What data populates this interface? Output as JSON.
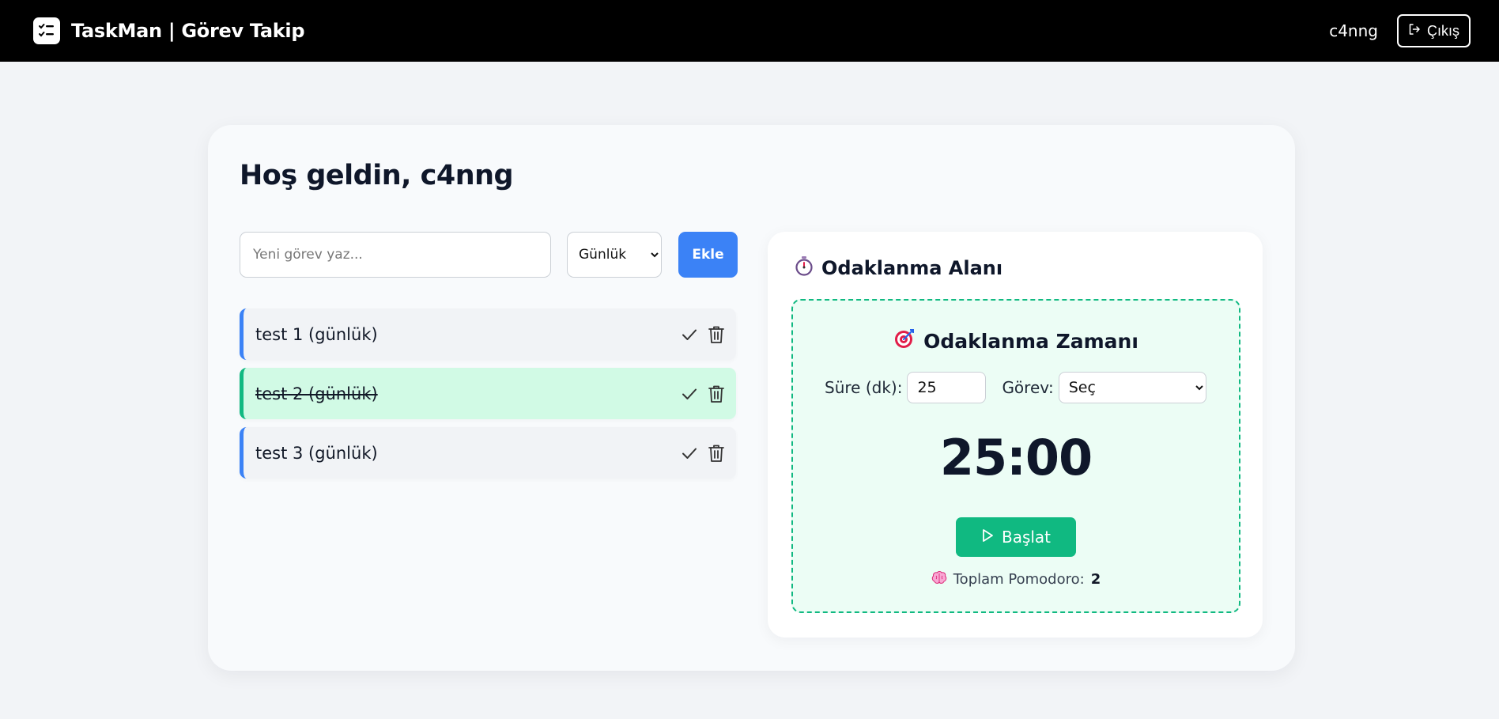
{
  "header": {
    "title": "TaskMan | Görev Takip",
    "username": "c4nng",
    "logout_label": "Çıkış"
  },
  "main": {
    "welcome": "Hoş geldin, c4nng",
    "new_task": {
      "placeholder": "Yeni görev yaz...",
      "period_selected": "Günlük",
      "add_label": "Ekle"
    },
    "tasks": [
      {
        "text": "test 1 (günlük)",
        "done": false
      },
      {
        "text": "test 2 (günlük)",
        "done": true
      },
      {
        "text": "test 3 (günlük)",
        "done": false
      }
    ]
  },
  "focus": {
    "title": "Odaklanma Alanı",
    "timer_title": "Odaklanma Zamanı",
    "duration_label": "Süre (dk):",
    "duration_value": "25",
    "task_label": "Görev:",
    "task_selected": "Seç",
    "time_display": "25:00",
    "start_label": "Başlat",
    "total_label": "Toplam Pomodoro:",
    "total_count": "2"
  },
  "colors": {
    "accent_blue": "#3b82f6",
    "accent_green": "#10b981",
    "done_bg": "#d1fae5",
    "pomo_bg": "#ecfdf5"
  },
  "icons": {
    "brand": "checklist-icon",
    "logout": "logout-icon",
    "complete": "check-icon",
    "delete": "trash-icon",
    "focus": "stopwatch-icon",
    "target": "target-icon",
    "start": "play-icon",
    "brain": "brain-icon"
  }
}
